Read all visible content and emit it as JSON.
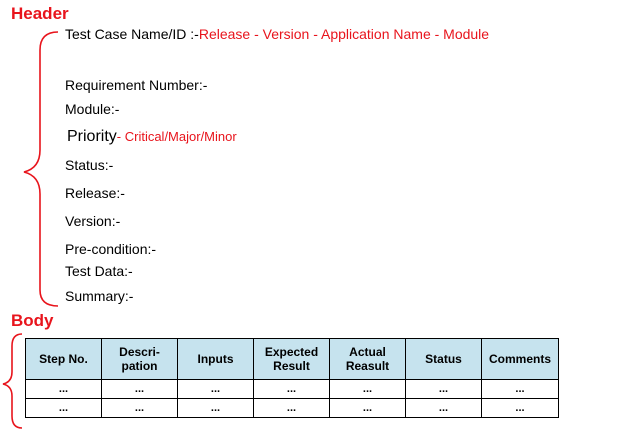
{
  "header": {
    "title": "Header",
    "test_case_label": "Test Case Name/ID :-",
    "test_case_value": "Release - Version - Application Name - Module",
    "requirement_number": "Requirement Number:-",
    "module": "Module:-",
    "priority_label": "Priority",
    "priority_value": "- Critical/Major/Minor",
    "status": "Status:-",
    "release": "Release:-",
    "version": "Version:-",
    "precondition": "Pre-condition:-",
    "test_data": "Test Data:-",
    "summary": "Summary:-"
  },
  "body": {
    "title": "Body",
    "columns": [
      [
        "Step No."
      ],
      [
        "Descri-",
        "pation"
      ],
      [
        "Inputs"
      ],
      [
        "Expected",
        "Result"
      ],
      [
        "Actual",
        "Reasult"
      ],
      [
        "Status"
      ],
      [
        "Comments"
      ]
    ],
    "rows": [
      [
        "...",
        "...",
        "...",
        "...",
        "...",
        "...",
        "..."
      ],
      [
        "...",
        "...",
        "...",
        "...",
        "...",
        "...",
        "..."
      ]
    ]
  },
  "colors": {
    "accent_red": "#e8141c",
    "header_cell_bg": "#c6e3ee"
  }
}
